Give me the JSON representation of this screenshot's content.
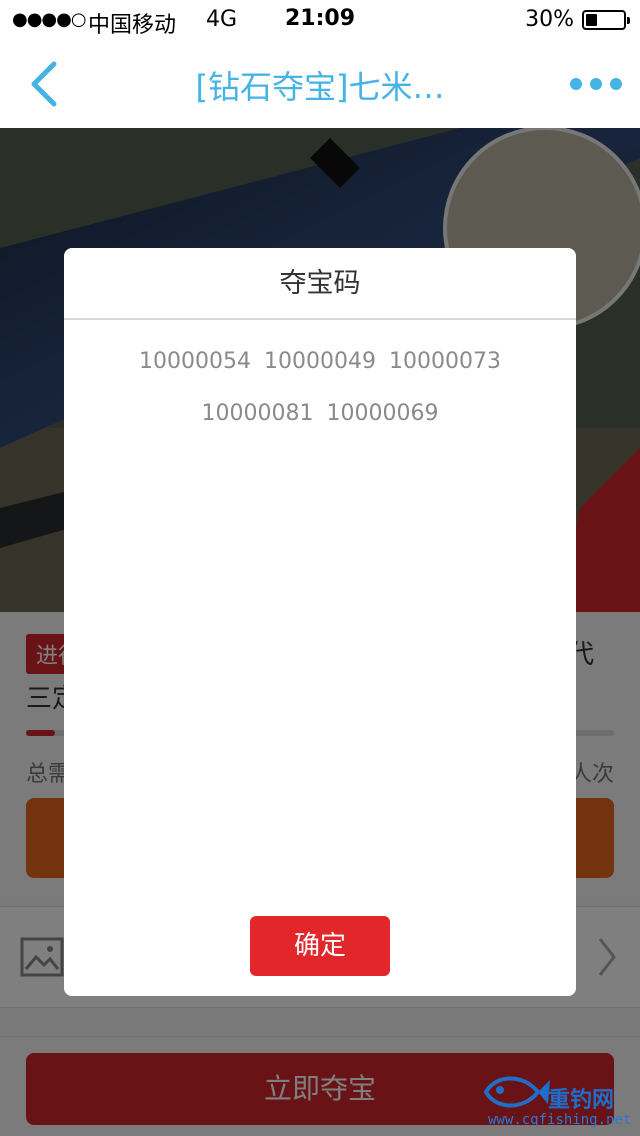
{
  "status_bar": {
    "signal": "●●●●○",
    "carrier": "中国移动",
    "network": "4G",
    "time": "21:09",
    "battery_percent": "30%",
    "battery_level": 0.3
  },
  "nav": {
    "title": "[钻石夺宝]七米…"
  },
  "page": {
    "badge_label": "进行",
    "product_line": "三定",
    "right_snippet": "代",
    "total_label": "总需",
    "count_unit": "人次",
    "progress": 0.05,
    "buy_label": "立即夺宝"
  },
  "modal": {
    "title": "夺宝码",
    "codes": [
      "10000054",
      "10000049",
      "10000073",
      "10000081",
      "10000069"
    ],
    "confirm_label": "确定"
  },
  "watermark": {
    "name": "重钓网",
    "url": "www.cqfishing.net"
  },
  "colors": {
    "accent_blue": "#45b3e5",
    "primary_red": "#e2262a",
    "action_orange": "#e5661c"
  }
}
